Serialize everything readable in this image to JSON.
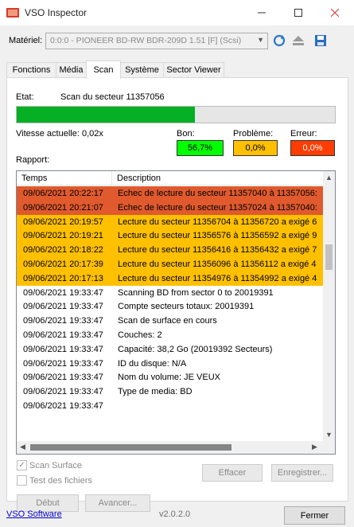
{
  "window": {
    "title": "VSO Inspector",
    "min_icon": "minimize-icon",
    "max_icon": "maximize-icon",
    "close_icon": "close-icon"
  },
  "toolbar": {
    "device_label": "Matériel:",
    "device_value": "0:0:0 - PIONEER BD-RW   BDR-209D 1.51 [F] (Scsi)"
  },
  "tabs": [
    "Fonctions",
    "Média",
    "Scan",
    "Système",
    "Sector Viewer"
  ],
  "scan": {
    "etat_label": "Etat:",
    "etat_value": "Scan du secteur 11357056",
    "progress": 0.56,
    "vitesse": "Vitesse actuelle: 0,02x",
    "bon_label": "Bon:",
    "bon_value": "56,7%",
    "probleme_label": "Problème:",
    "probleme_value": "0,0%",
    "erreur_label": "Erreur:",
    "erreur_value": "0,0%",
    "rapport_label": "Rapport:",
    "col_temps": "Temps",
    "col_description": "Description",
    "rows": [
      {
        "time": "09/06/2021 20:22:17",
        "desc": "Echec de lecture du secteur 11357040 à 11357056: ",
        "level": "error"
      },
      {
        "time": "09/06/2021 20:21:07",
        "desc": "Echec de lecture du secteur 11357024 à 11357040: ",
        "level": "error"
      },
      {
        "time": "09/06/2021 20:19:57",
        "desc": "Lecture du secteur 11356704 à 11356720 a exigé 6 ",
        "level": "warn"
      },
      {
        "time": "09/06/2021 20:19:21",
        "desc": "Lecture du secteur 11356576 à 11356592 a exigé 9 ",
        "level": "warn"
      },
      {
        "time": "09/06/2021 20:18:22",
        "desc": "Lecture du secteur 11356416 à 11356432 a exigé 7 ",
        "level": "warn"
      },
      {
        "time": "09/06/2021 20:17:39",
        "desc": "Lecture du secteur 11356096 à 11356112 a exigé 4 ",
        "level": "warn"
      },
      {
        "time": "09/06/2021 20:17:13",
        "desc": "Lecture du secteur 11354976 à 11354992 a exigé 4 ",
        "level": "warn"
      },
      {
        "time": "09/06/2021 19:33:47",
        "desc": "Scanning BD from sector 0 to 20019391",
        "level": "info"
      },
      {
        "time": "09/06/2021 19:33:47",
        "desc": "Compte secteurs totaux: 20019391",
        "level": "info"
      },
      {
        "time": "09/06/2021 19:33:47",
        "desc": "Scan de surface en cours",
        "level": "info"
      },
      {
        "time": "09/06/2021 19:33:47",
        "desc": "Couches: 2",
        "level": "info"
      },
      {
        "time": "09/06/2021 19:33:47",
        "desc": "Capacité: 38,2 Go (20019392 Secteurs)",
        "level": "info"
      },
      {
        "time": "09/06/2021 19:33:47",
        "desc": "ID du disque: N/A",
        "level": "info"
      },
      {
        "time": "09/06/2021 19:33:47",
        "desc": "Nom du volume: JE VEUX",
        "level": "info"
      },
      {
        "time": "09/06/2021 19:33:47",
        "desc": "Type de media: BD",
        "level": "info"
      },
      {
        "time": "09/06/2021 19:33:47",
        "desc": "",
        "level": "info"
      }
    ],
    "scan_surface": "Scan Surface",
    "test_fichiers": "Test des fichiers",
    "effacer": "Effacer",
    "enregistrer": "Enregistrer...",
    "debut": "Début",
    "avancer": "Avancer..."
  },
  "footer": {
    "link": "VSO Software",
    "version": "v2.0.2.0",
    "fermer": "Fermer"
  },
  "colors": {
    "error": "#e05a2e",
    "warn": "#ffc000",
    "good": "#00ff00",
    "bon_box": "#00ff00",
    "probleme_box": "#ffc000",
    "erreur_box": "#ff3d00",
    "progress": "#06b025"
  }
}
